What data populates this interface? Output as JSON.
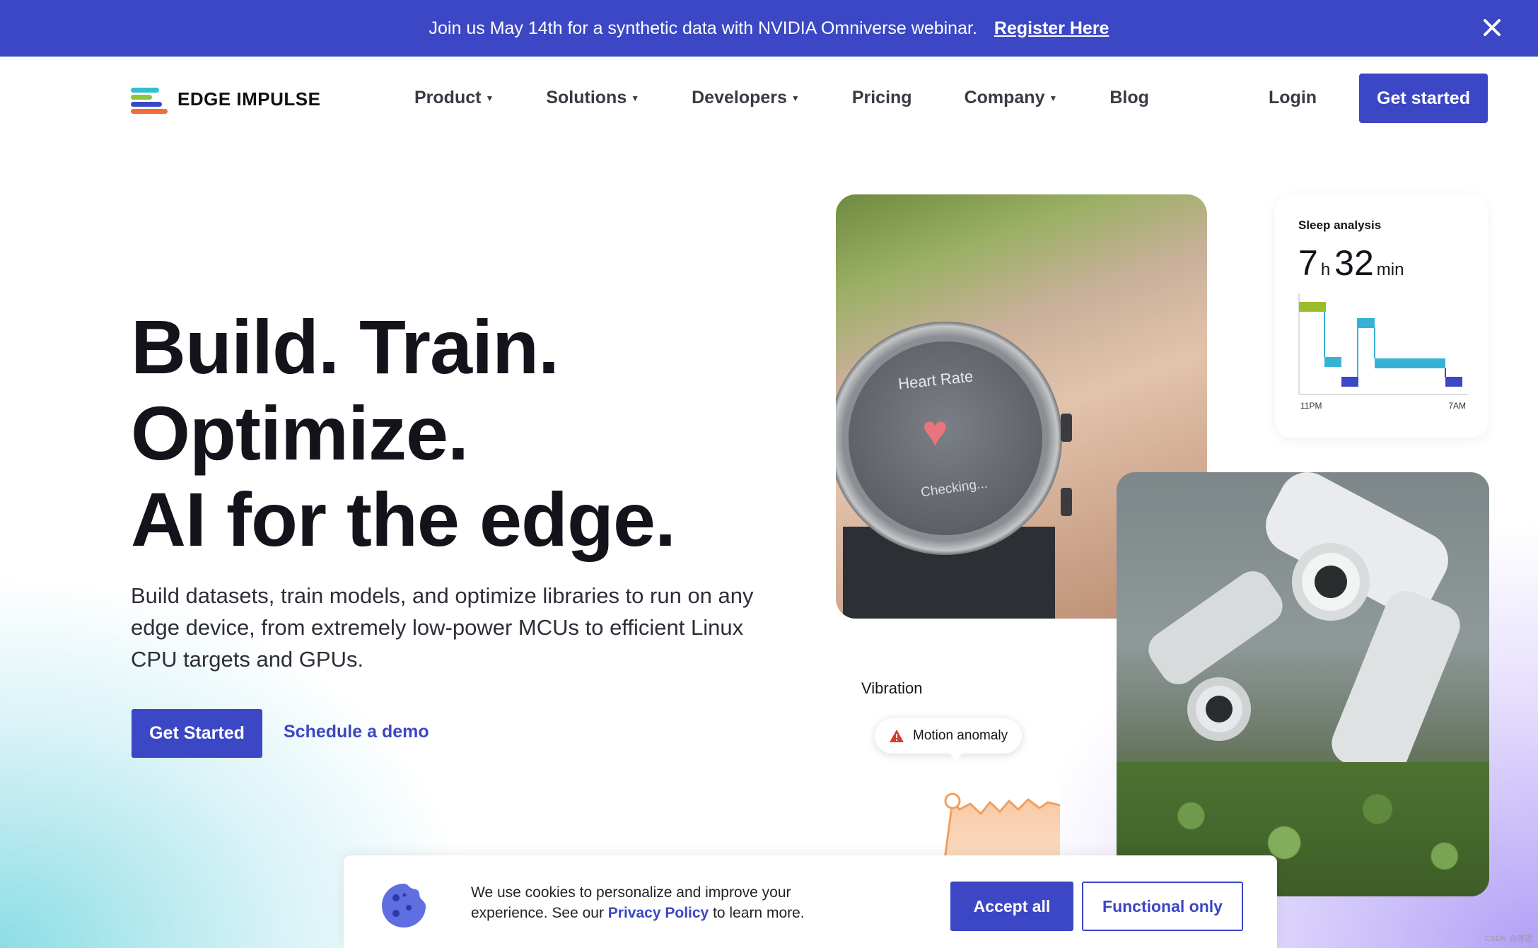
{
  "banner": {
    "message": "Join us May 14th for a synthetic data with NVIDIA Omniverse webinar.",
    "link": "Register Here",
    "close_icon": "close-icon",
    "background": "#3b47c4"
  },
  "header": {
    "logo_text": "EDGE IMPULSE",
    "logo_colors": [
      "#2fbfd0",
      "#8cc63f",
      "#3b47c4",
      "#f26b3a"
    ],
    "nav": [
      {
        "label": "Product",
        "dropdown": true
      },
      {
        "label": "Solutions",
        "dropdown": true
      },
      {
        "label": "Developers",
        "dropdown": true
      },
      {
        "label": "Pricing",
        "dropdown": false
      },
      {
        "label": "Company",
        "dropdown": true
      },
      {
        "label": "Blog",
        "dropdown": false
      }
    ],
    "login": "Login",
    "cta": "Get started"
  },
  "hero": {
    "headline": [
      "Build. Train.",
      "Optimize.",
      "AI for the edge."
    ],
    "subtitle": "Build datasets, train models, and optimize libraries to run on any edge device, from extremely low-power MCUs to efficient Linux CPU targets and GPUs.",
    "primary_cta": "Get Started",
    "secondary_cta": "Schedule a demo"
  },
  "watch_card": {
    "title": "Heart Rate",
    "status": "Checking..."
  },
  "sleep_card": {
    "title": "Sleep analysis",
    "hours": "7",
    "hours_unit": "h",
    "minutes": "32",
    "minutes_unit": "min",
    "start_label": "11PM",
    "end_label": "7AM",
    "colors": {
      "awake": "#9bbd2a",
      "light": "#35b3d6",
      "deep": "#3b47c4"
    }
  },
  "vibration_card": {
    "title": "Vibration",
    "alert": "Motion anomaly",
    "alert_color": "#d93a2b",
    "line_color": "#f0a060"
  },
  "cookie": {
    "text_before": "We use cookies to personalize and improve your experience. See our ",
    "policy_link": "Privacy Policy",
    "text_after": " to learn more.",
    "accept": "Accept all",
    "functional": "Functional only",
    "icon": "cookie-icon"
  },
  "watermark": "CSDN @唐锲"
}
